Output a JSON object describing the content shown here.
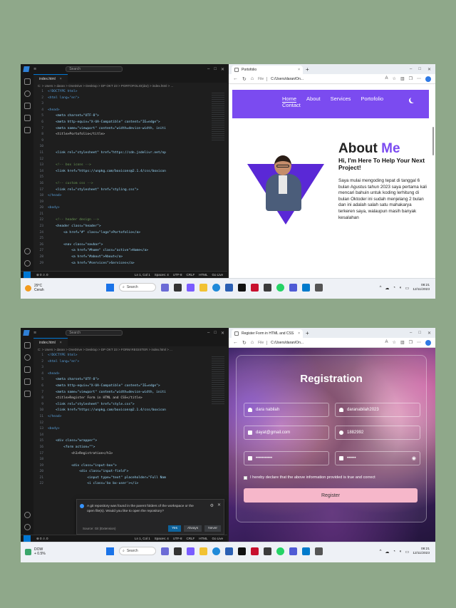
{
  "shot1": {
    "vscode": {
      "menu": "≡",
      "search_placeholder": "Search",
      "tab": "index.html",
      "breadcrumb": "C: > Users > daran > OneDrive > Desktop > DP OKT 23 > PORTOFOLIO(dar) > index.html > ...",
      "lines": [
        {
          "n": "1",
          "t": "<!DOCTYPE html>",
          "c": "tag"
        },
        {
          "n": "2",
          "t": "<html lang=\"en\">",
          "c": "tag"
        },
        {
          "n": "3",
          "t": "",
          "c": "plain"
        },
        {
          "n": "4",
          "t": "<head>",
          "c": "tag"
        },
        {
          "n": "5",
          "t": "    <meta charset=\"UTF-8\">",
          "c": "txt"
        },
        {
          "n": "6",
          "t": "    <meta http-equiv=\"X-UA-Compatible\" content=\"IE=edge\">",
          "c": "txt"
        },
        {
          "n": "7",
          "t": "    <meta name=\"viewport\" content=\"width=device-width, initi",
          "c": "txt"
        },
        {
          "n": "8",
          "t": "    <title>Portofolio</title>",
          "c": "plain"
        },
        {
          "n": "9",
          "t": "",
          "c": "plain"
        },
        {
          "n": "10",
          "t": "",
          "c": "plain"
        },
        {
          "n": "11",
          "t": "    <link rel=\"stylesheet\" href=\"https://cdn.jsdelivr.net/np",
          "c": "txt"
        },
        {
          "n": "12",
          "t": "",
          "c": "plain"
        },
        {
          "n": "13",
          "t": "    <!-- box icons -->",
          "c": "cmt"
        },
        {
          "n": "14",
          "t": "    <link href=\"https://unpkg.com/boxicons@2.1.4/css/boxicon",
          "c": "txt"
        },
        {
          "n": "15",
          "t": "",
          "c": "plain"
        },
        {
          "n": "16",
          "t": "    <!-- custom css -->",
          "c": "cmt"
        },
        {
          "n": "17",
          "t": "    <link rel=\"stylesheet\" href=\"styling.css\">",
          "c": "txt"
        },
        {
          "n": "18",
          "t": "</head>",
          "c": "tag"
        },
        {
          "n": "19",
          "t": "",
          "c": "plain"
        },
        {
          "n": "20",
          "t": "<body>",
          "c": "tag"
        },
        {
          "n": "21",
          "t": "",
          "c": "plain"
        },
        {
          "n": "22",
          "t": "    <!-- header design -->",
          "c": "cmt"
        },
        {
          "n": "23",
          "t": "    <header class=\"header\">",
          "c": "txt"
        },
        {
          "n": "24",
          "t": "        <a href=\"#\" class=\"logo\">Portofolio</a>",
          "c": "txt"
        },
        {
          "n": "25",
          "t": "",
          "c": "plain"
        },
        {
          "n": "26",
          "t": "        <nav class=\"navbar\">",
          "c": "txt"
        },
        {
          "n": "27",
          "t": "            <a href=\"#home\" class=\"active\">Home</a>",
          "c": "txt"
        },
        {
          "n": "28",
          "t": "            <a href=\"#about\">About</a>",
          "c": "txt"
        },
        {
          "n": "29",
          "t": "            <a href=\"#services\">Services</a>",
          "c": "txt"
        }
      ],
      "status": {
        "left": "⊗ 0 ⚠ 0",
        "pos": "Ln 1, Col 1",
        "spaces": "Spaces: 4",
        "enc": "UTF-8",
        "eol": "CRLF",
        "lang": "HTML",
        "live": "Go Live"
      }
    },
    "browser": {
      "tab_title": "Portofolio",
      "url": "C:/Users/daran/On...",
      "file_label": "File",
      "page": {
        "nav": [
          "Home",
          "About",
          "Services",
          "Portofolio"
        ],
        "contact": "Contact",
        "title_plain": "About ",
        "title_accent": "Me",
        "subtitle": "Hi, I'm Here To Help Your Next Project!",
        "paragraph": "Saya mulai mengoding tepat di tanggal 6 bulan Agustus tahun 2023 saya pertama kali mencari bahuin untuk koding lerhitung di bulan Oktoder ini sudah menjelang 2 bulan dan ini adalah salah satu mahakarya terkeren saya, walaupun masih banyak kesalahan"
      }
    },
    "taskbar": {
      "weather_temp": "29°C",
      "weather_desc": "Cerah",
      "search": "Search",
      "time": "08:21",
      "date": "12/11/2023"
    }
  },
  "shot2": {
    "vscode": {
      "menu": "≡",
      "search_placeholder": "Search",
      "tab": "index.html",
      "breadcrumb": "C: > Users > daran > OneDrive > Desktop > DP OKT 23 > FORM REGISTER > index.html > ...",
      "lines": [
        {
          "n": "1",
          "t": "<!DOCTYPE html>",
          "c": "tag"
        },
        {
          "n": "2",
          "t": "<html lang=\"en\">",
          "c": "tag"
        },
        {
          "n": "3",
          "t": "",
          "c": "plain"
        },
        {
          "n": "4",
          "t": "<head>",
          "c": "tag"
        },
        {
          "n": "5",
          "t": "    <meta charset=\"UTF-8\">",
          "c": "txt"
        },
        {
          "n": "6",
          "t": "    <meta http-equiv=\"X-UA-Compatible\" content=\"IE=edge\">",
          "c": "txt"
        },
        {
          "n": "7",
          "t": "    <meta name=\"viewport\" content=\"width=device-width, initi",
          "c": "txt"
        },
        {
          "n": "8",
          "t": "    <title>Register Form in HTML and CSS</title>",
          "c": "plain"
        },
        {
          "n": "9",
          "t": "    <link rel=\"stylesheet\" href=\"style.css\">",
          "c": "txt"
        },
        {
          "n": "10",
          "t": "    <link href=\"https://unpkg.com/boxicons@2.1.4/css/boxicon",
          "c": "txt"
        },
        {
          "n": "11",
          "t": "</head>",
          "c": "tag"
        },
        {
          "n": "12",
          "t": "",
          "c": "plain"
        },
        {
          "n": "13",
          "t": "<body>",
          "c": "tag"
        },
        {
          "n": "14",
          "t": "",
          "c": "plain"
        },
        {
          "n": "15",
          "t": "    <div class=\"wrapper\">",
          "c": "txt"
        },
        {
          "n": "16",
          "t": "        <form action=\"\">",
          "c": "txt"
        },
        {
          "n": "17",
          "t": "            <h1>Registration</h1>",
          "c": "plain"
        },
        {
          "n": "18",
          "t": "",
          "c": "plain"
        },
        {
          "n": "19",
          "t": "            <div class=\"input-box\">",
          "c": "txt"
        },
        {
          "n": "20",
          "t": "                <div class=\"input-field\">",
          "c": "txt"
        },
        {
          "n": "21",
          "t": "                    <input type=\"text\" placeholder=\"Full Nam",
          "c": "txt"
        },
        {
          "n": "22",
          "t": "                    <i class='bx bx-user'></i>",
          "c": "txt"
        }
      ],
      "notification": {
        "message": "A git repository was found in the parent folders of the workspace or the open file(s). Would you like to open the repository?",
        "source": "Source: Git (Extension)",
        "buttons": [
          "Yes",
          "Always",
          "Never"
        ]
      },
      "status": {
        "left": "⊗ 0 ⚠ 0",
        "pos": "Ln 1, Col 1",
        "spaces": "Spaces: 4",
        "enc": "UTF-8",
        "eol": "CRLF",
        "lang": "HTML",
        "live": "Go Live"
      }
    },
    "browser": {
      "tab_title": "Register Form in HTML and CSS",
      "url": "C:/Users/daran/On...",
      "file_label": "File",
      "page": {
        "title": "Registration",
        "fullname": "dara nabilah",
        "username": "daranabilah2023",
        "email": "dayat@gmail.com",
        "phone": "1882992",
        "password": "•••••••••••",
        "confirm": "••••••",
        "checkbox": "I hereby declare that the above information provided is true and correct",
        "button": "Register"
      }
    },
    "taskbar": {
      "weather_temp": "DOW",
      "weather_desc": "+ 0.5%",
      "search": "Search",
      "time": "08:21",
      "date": "12/11/2023"
    }
  }
}
